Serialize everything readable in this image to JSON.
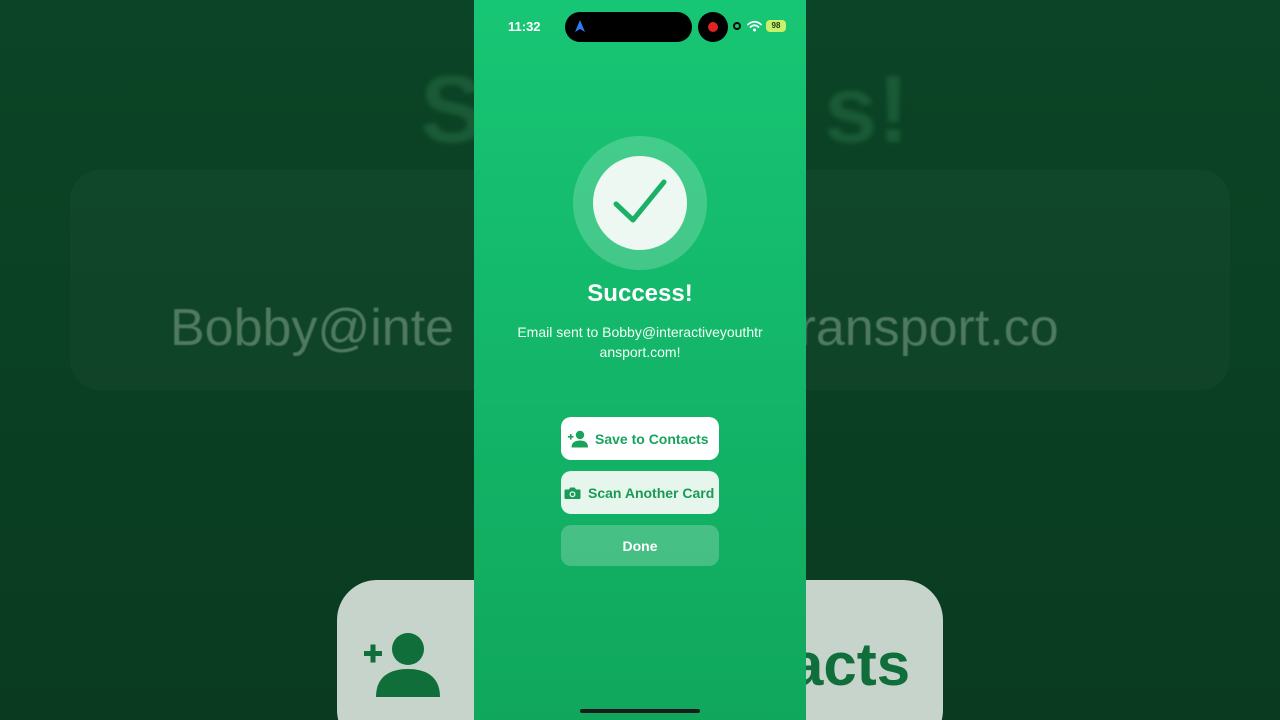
{
  "status_bar": {
    "time": "11:32",
    "battery": "98"
  },
  "success": {
    "title": "Success!",
    "message": "Email sent to Bobby@interactiveyouthtransport.com!"
  },
  "buttons": {
    "save_contacts": "Save to Contacts",
    "scan_another": "Scan Another Card",
    "done": "Done"
  },
  "colors": {
    "accent_green": "#13b568",
    "button_text_green": "#1aa35d"
  },
  "icons": {
    "status": [
      "navigation-arrow-icon",
      "recording-dot-icon",
      "wifi-icon",
      "battery-icon"
    ],
    "content": [
      "checkmark-icon",
      "add-person-icon",
      "camera-icon"
    ]
  },
  "background": {
    "title_fragment_left": "S",
    "title_fragment_right": "s!",
    "email_fragment_left": "Bobby@inte",
    "email_fragment_right": "transport.co",
    "button_fragment": "acts"
  }
}
